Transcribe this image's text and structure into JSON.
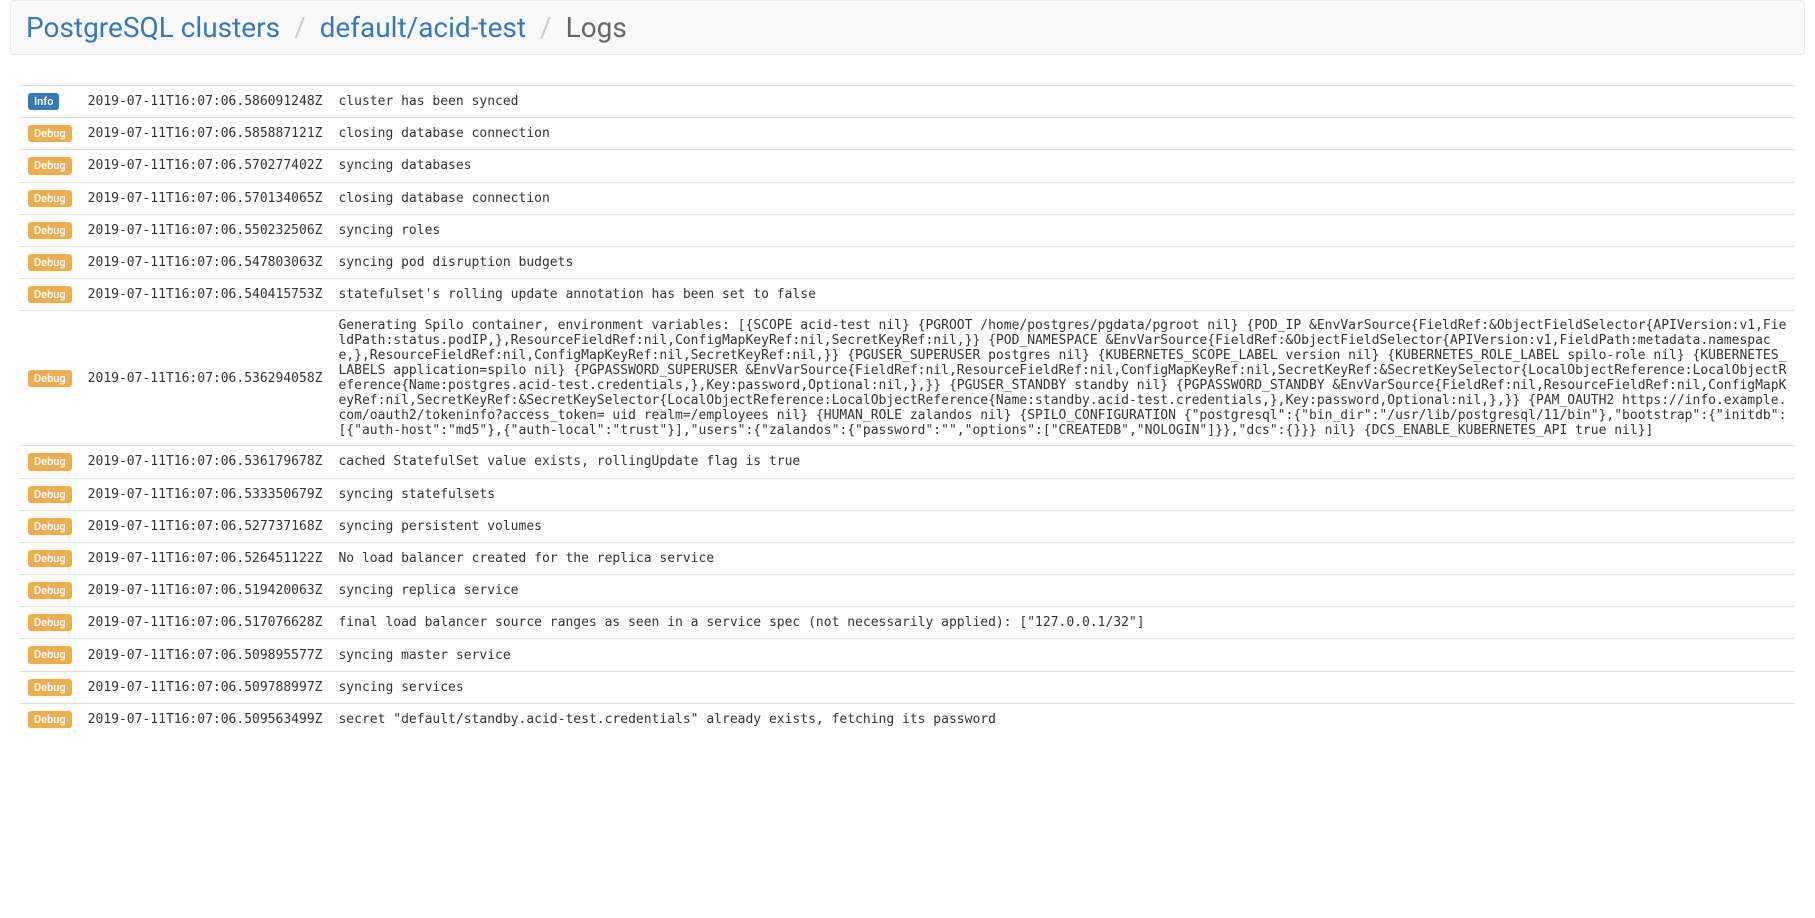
{
  "breadcrumb": {
    "root": "PostgreSQL clusters",
    "cluster": "default/acid-test",
    "current": "Logs"
  },
  "levels": {
    "info": "Info",
    "debug": "Debug"
  },
  "logs": [
    {
      "level": "info",
      "time": "2019-07-11T16:07:06.586091248Z",
      "msg": "cluster has been synced"
    },
    {
      "level": "debug",
      "time": "2019-07-11T16:07:06.585887121Z",
      "msg": "closing database connection"
    },
    {
      "level": "debug",
      "time": "2019-07-11T16:07:06.570277402Z",
      "msg": "syncing databases"
    },
    {
      "level": "debug",
      "time": "2019-07-11T16:07:06.570134065Z",
      "msg": "closing database connection"
    },
    {
      "level": "debug",
      "time": "2019-07-11T16:07:06.550232506Z",
      "msg": "syncing roles"
    },
    {
      "level": "debug",
      "time": "2019-07-11T16:07:06.547803063Z",
      "msg": "syncing pod disruption budgets"
    },
    {
      "level": "debug",
      "time": "2019-07-11T16:07:06.540415753Z",
      "msg": "statefulset's rolling update annotation has been set to false"
    },
    {
      "level": "debug",
      "time": "2019-07-11T16:07:06.536294058Z",
      "msg": "Generating Spilo container, environment variables: [{SCOPE acid-test nil} {PGROOT /home/postgres/pgdata/pgroot nil} {POD_IP &EnvVarSource{FieldRef:&ObjectFieldSelector{APIVersion:v1,FieldPath:status.podIP,},ResourceFieldRef:nil,ConfigMapKeyRef:nil,SecretKeyRef:nil,}} {POD_NAMESPACE &EnvVarSource{FieldRef:&ObjectFieldSelector{APIVersion:v1,FieldPath:metadata.namespace,},ResourceFieldRef:nil,ConfigMapKeyRef:nil,SecretKeyRef:nil,}} {PGUSER_SUPERUSER postgres nil} {KUBERNETES_SCOPE_LABEL version nil} {KUBERNETES_ROLE_LABEL spilo-role nil} {KUBERNETES_LABELS application=spilo nil} {PGPASSWORD_SUPERUSER &EnvVarSource{FieldRef:nil,ResourceFieldRef:nil,ConfigMapKeyRef:nil,SecretKeyRef:&SecretKeySelector{LocalObjectReference:LocalObjectReference{Name:postgres.acid-test.credentials,},Key:password,Optional:nil,},}} {PGUSER_STANDBY standby nil} {PGPASSWORD_STANDBY &EnvVarSource{FieldRef:nil,ResourceFieldRef:nil,ConfigMapKeyRef:nil,SecretKeyRef:&SecretKeySelector{LocalObjectReference:LocalObjectReference{Name:standby.acid-test.credentials,},Key:password,Optional:nil,},}} {PAM_OAUTH2 https://info.example.com/oauth2/tokeninfo?access_token= uid realm=/employees nil} {HUMAN_ROLE zalandos nil} {SPILO_CONFIGURATION {\"postgresql\":{\"bin_dir\":\"/usr/lib/postgresql/11/bin\"},\"bootstrap\":{\"initdb\":[{\"auth-host\":\"md5\"},{\"auth-local\":\"trust\"}],\"users\":{\"zalandos\":{\"password\":\"\",\"options\":[\"CREATEDB\",\"NOLOGIN\"]}},\"dcs\":{}}} nil} {DCS_ENABLE_KUBERNETES_API true nil}]"
    },
    {
      "level": "debug",
      "time": "2019-07-11T16:07:06.536179678Z",
      "msg": "cached StatefulSet value exists, rollingUpdate flag is true"
    },
    {
      "level": "debug",
      "time": "2019-07-11T16:07:06.533350679Z",
      "msg": "syncing statefulsets"
    },
    {
      "level": "debug",
      "time": "2019-07-11T16:07:06.527737168Z",
      "msg": "syncing persistent volumes"
    },
    {
      "level": "debug",
      "time": "2019-07-11T16:07:06.526451122Z",
      "msg": "No load balancer created for the replica service"
    },
    {
      "level": "debug",
      "time": "2019-07-11T16:07:06.519420063Z",
      "msg": "syncing replica service"
    },
    {
      "level": "debug",
      "time": "2019-07-11T16:07:06.517076628Z",
      "msg": "final load balancer source ranges as seen in a service spec (not necessarily applied): [\"127.0.0.1/32\"]"
    },
    {
      "level": "debug",
      "time": "2019-07-11T16:07:06.509895577Z",
      "msg": "syncing master service"
    },
    {
      "level": "debug",
      "time": "2019-07-11T16:07:06.509788997Z",
      "msg": "syncing services"
    },
    {
      "level": "debug",
      "time": "2019-07-11T16:07:06.509563499Z",
      "msg": "secret \"default/standby.acid-test.credentials\" already exists, fetching its password"
    }
  ]
}
